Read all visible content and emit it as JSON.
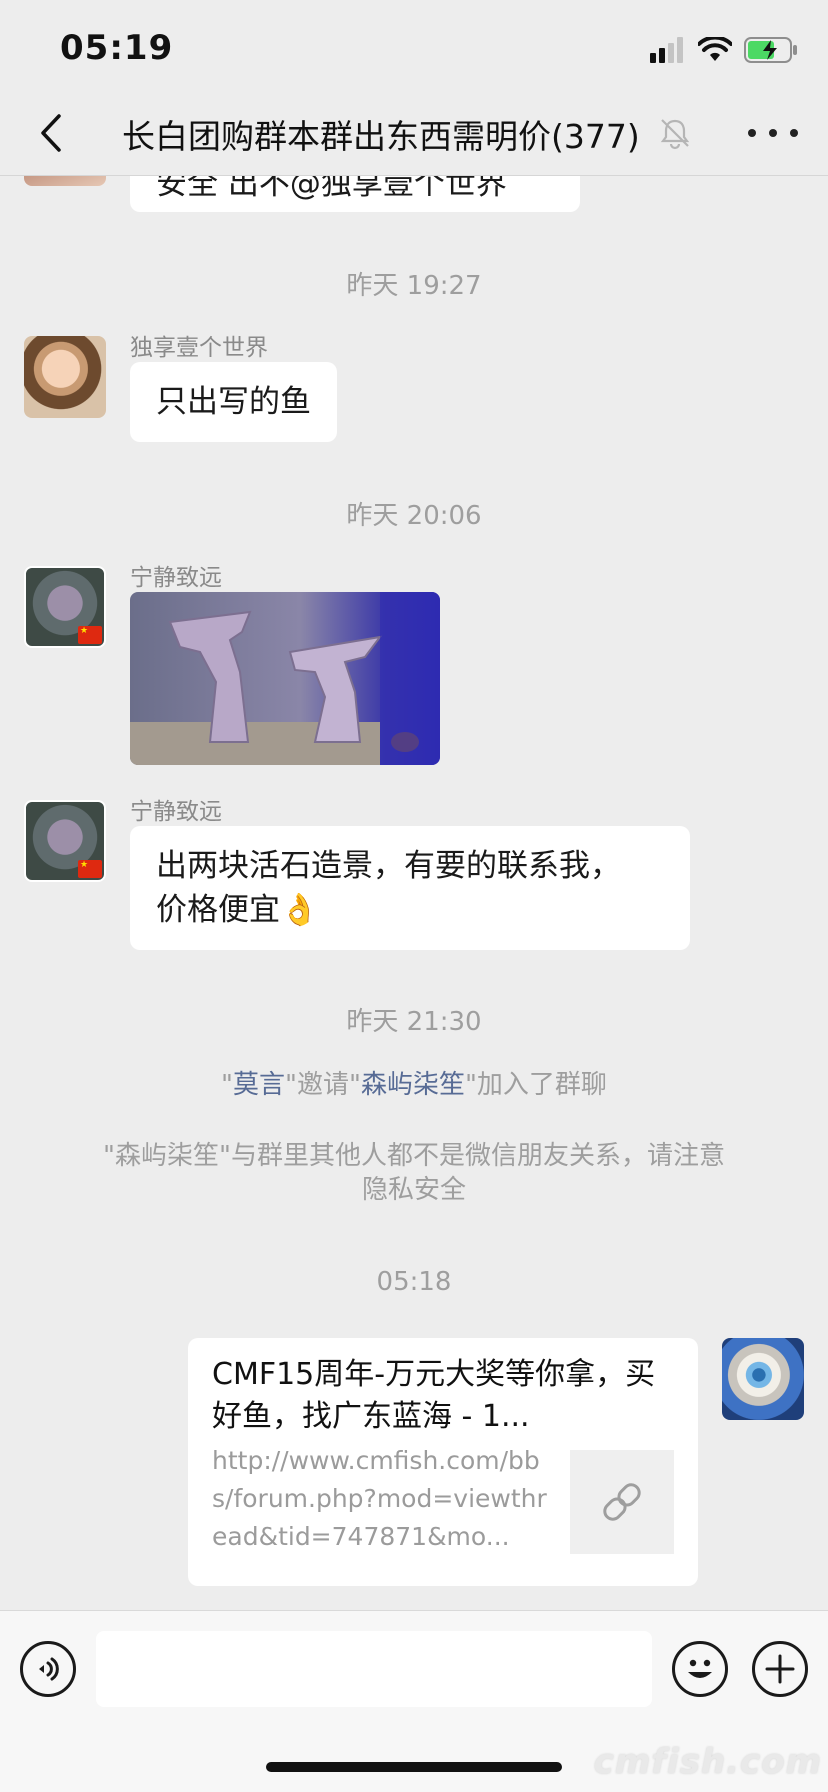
{
  "status_bar": {
    "time": "05:19"
  },
  "nav": {
    "title": "长白团购群本群出东西需明价(377)"
  },
  "partial_message": {
    "text": "安全 出不@独享壹个世界"
  },
  "messages": {
    "t1": "昨天 19:27",
    "m1": {
      "sender": "独享壹个世界",
      "text": "只出写的鱼"
    },
    "t2": "昨天 20:06",
    "m2": {
      "sender": "宁静致远"
    },
    "m3": {
      "sender": "宁静致远",
      "line1": "出两块活石造景，有要的联系我，",
      "line2": "价格便宜",
      "emoji": "👌"
    },
    "t3": "昨天 21:30",
    "sys1": {
      "q1": "\"",
      "inviter": "莫言",
      "mid": "\"邀请\"",
      "invitee": "森屿柒笙",
      "end": "\"加入了群聊"
    },
    "sys2": {
      "line1": "\"森屿柒笙\"与群里其他人都不是微信朋友关系，请注意",
      "line2": "隐私安全"
    },
    "t4": "05:18",
    "link_card": {
      "title": "CMF15周年-万元大奖等你拿，买好鱼，找广东蓝海 - 1...",
      "url": "http://www.cmfish.com/bbs/forum.php?mod=viewthread&tid=747871&mo..."
    }
  },
  "input": {
    "placeholder": ""
  },
  "watermark": "cmfish.com",
  "colors": {
    "background": "#ededed",
    "bubble": "#ffffff",
    "link": "#576b95",
    "battery": "#4cd964"
  }
}
